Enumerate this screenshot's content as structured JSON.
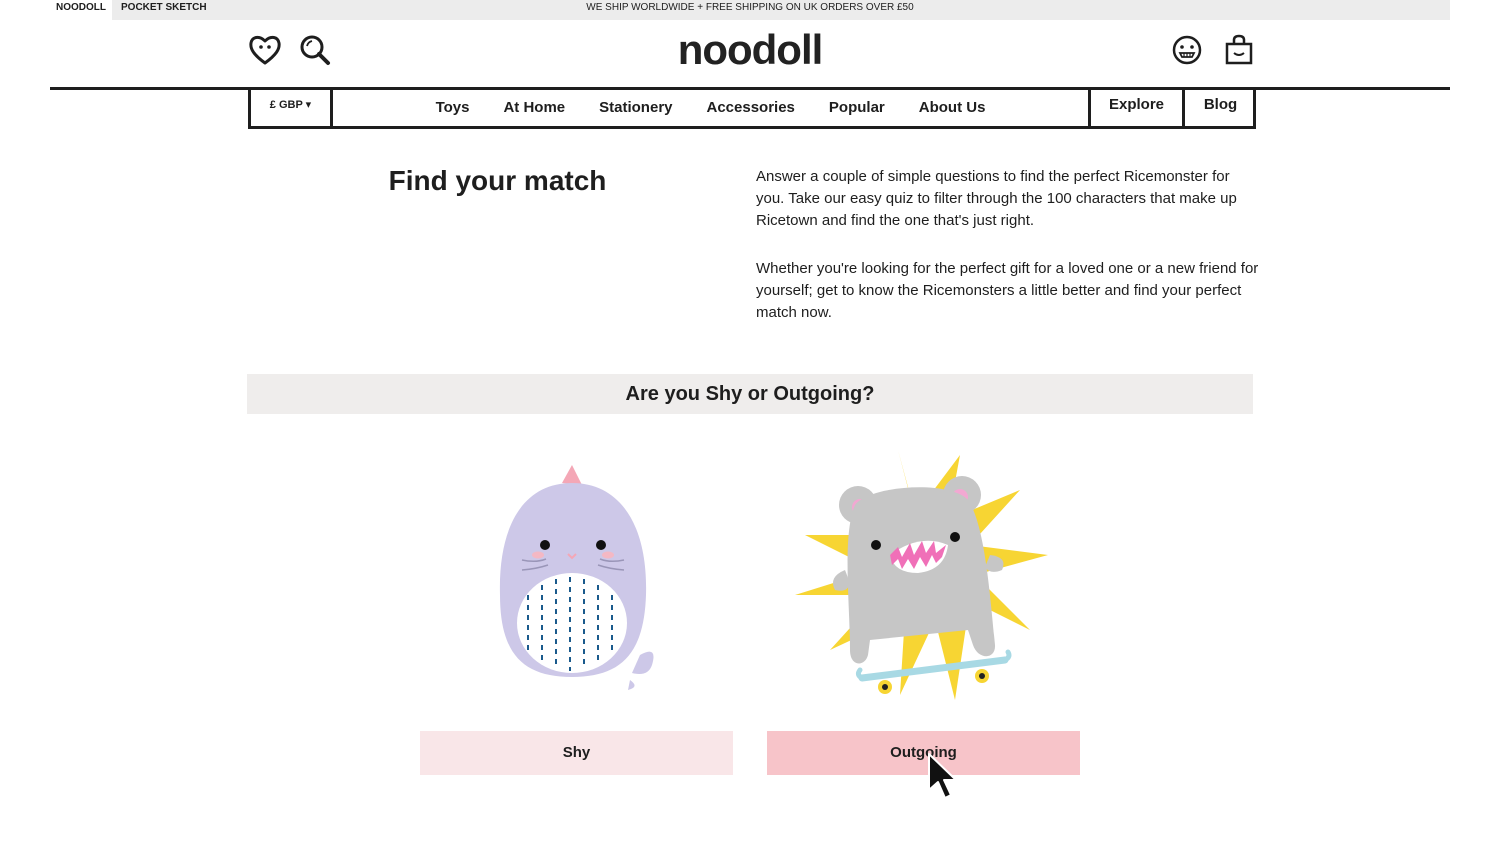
{
  "topbar": {
    "tabs": [
      {
        "label": "Noodoll"
      },
      {
        "label": "Pocket Sketch"
      }
    ],
    "shipping_message": "WE SHIP WORLDWIDE + FREE SHIPPING ON UK ORDERS OVER £50"
  },
  "header": {
    "logo": "noodoll",
    "icons": [
      "heart-icon",
      "search-icon",
      "account-face-icon",
      "shopping-bag-icon"
    ]
  },
  "nav": {
    "currency": "£ GBP ▾",
    "links": [
      "Toys",
      "At Home",
      "Stationery",
      "Accessories",
      "Popular",
      "About Us"
    ],
    "explore": "Explore",
    "blog": "Blog"
  },
  "main": {
    "title": "Find your match",
    "paragraphs": [
      "Answer a couple of simple questions to find the perfect Ricemonster for you. Take our easy quiz to filter through the 100 characters that make up Ricetown and find the one that's just right.",
      "Whether you're looking for the perfect gift for a loved one or a new friend for yourself; get to know the Ricemonsters a little better and find your perfect match now."
    ]
  },
  "quiz": {
    "question": "Are you Shy or Outgoing?",
    "options": [
      {
        "label": "Shy",
        "image": "shy-purple-whale-character"
      },
      {
        "label": "Outgoing",
        "image": "outgoing-grey-monster-skateboard-character"
      }
    ]
  },
  "colors": {
    "shy_button": "#f9e6e8",
    "outgoing_button": "#f7c4c9",
    "question_bar": "#efedec",
    "text": "#1e1e1e"
  }
}
